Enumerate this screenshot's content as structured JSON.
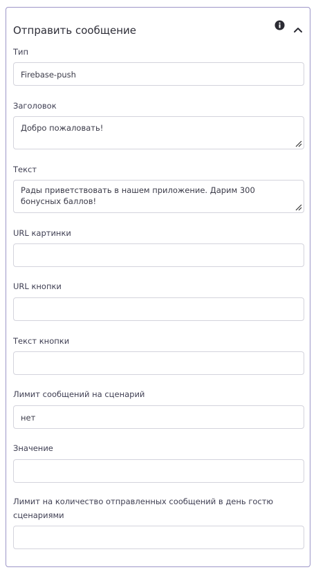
{
  "panel": {
    "title": "Отправить сообщение"
  },
  "icons": {
    "info": "info-circle-icon",
    "collapse": "chevron-up-icon",
    "resize": "resize-grip-icon"
  },
  "colors": {
    "border_accent": "#9c95c8",
    "input_border": "#d3d3dc",
    "text": "#2e2e38"
  },
  "fields": {
    "type": {
      "label": "Тип",
      "value": "Firebase-push"
    },
    "heading": {
      "label": "Заголовок",
      "value": "Добро пожаловать!"
    },
    "text": {
      "label": "Текст",
      "value": "Рады приветствовать в нашем приложение. Дарим 300 бонусных баллов!"
    },
    "image_url": {
      "label": "URL картинки",
      "value": ""
    },
    "button_url": {
      "label": "URL кнопки",
      "value": ""
    },
    "button_text": {
      "label": "Текст кнопки",
      "value": ""
    },
    "scenario_limit": {
      "label": "Лимит сообщений на сценарий",
      "value": "нет"
    },
    "limit_value": {
      "label": "Значение",
      "value": ""
    },
    "daily_limit": {
      "label": "Лимит на количество отправленных сообщений в день гостю сценариями",
      "value": ""
    }
  }
}
